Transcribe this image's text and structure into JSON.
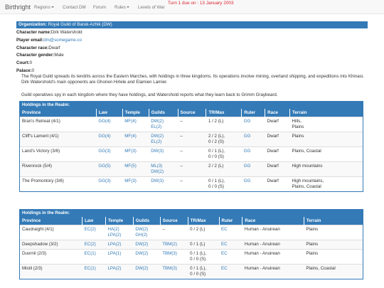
{
  "nav": {
    "brand": "Birthright",
    "items": [
      {
        "label": "Regions",
        "dropdown": true
      },
      {
        "label": "Contact DM",
        "dropdown": false
      },
      {
        "label": "Forum",
        "dropdown": false
      },
      {
        "label": "Rules",
        "dropdown": true
      },
      {
        "label": "Levels of War",
        "dropdown": false
      }
    ],
    "turn_notice": "Turn 1 due on : 13 January 2003"
  },
  "org": {
    "header_label": "Organization:",
    "header_value": "Royal Guild of Baruk-Azhik (DW)",
    "fields": [
      {
        "label": "Character name:",
        "value": "Dirk Watershold",
        "link": false
      },
      {
        "label": "Player email:",
        "value": "dm@somegame.co",
        "link": true
      },
      {
        "label": "Character race:",
        "value": "Dwarf",
        "link": false
      },
      {
        "label": "Character gender:",
        "value": "Male",
        "link": false
      },
      {
        "label": "Court:",
        "value": "0",
        "link": false
      },
      {
        "label": "Palace:",
        "value": "0",
        "link": false
      }
    ],
    "description_1": "The Royal Guild spreads its tendrils across the Eastern Marches, with holdings in three kingdoms. Its operations involve mining, overland shipping, and expeditions into Khinasi. Dirk Watershold's main opponents are Ghorien Hirlele and Elamien Lamier.",
    "description_2": "Guild operatives spy in each kingdom where they have holdings, and Watershold reports what they learn back to Grimm Graybeard."
  },
  "realms": [
    {
      "title": "Holdings in the Realm:",
      "columns": [
        "Province",
        "Law",
        "Temple",
        "Guilds",
        "Source",
        "TR/Max",
        "Ruler",
        "Race",
        "Terrain"
      ],
      "rows": [
        {
          "province": "Bran's Retreat (4/1)",
          "law": "GG(4)",
          "temple": "MF(4)",
          "guilds": [
            "DW(2)",
            "EL(2)"
          ],
          "source": "--",
          "trmax": [
            "1 / 2 (L)"
          ],
          "ruler": "GG",
          "race": "Dwarf",
          "terrain": [
            "Hills,",
            "Plains"
          ]
        },
        {
          "province": "Cliff's Lament (4/1)",
          "law": "GG(4)",
          "temple": "MF(4)",
          "guilds": [
            "DW(2)",
            "EL(2)"
          ],
          "source": "--",
          "trmax": [
            "2 / 2 (L),",
            "0 / 2 (S)"
          ],
          "ruler": "GG",
          "race": "Dwarf",
          "terrain": [
            "Plains"
          ]
        },
        {
          "province": "Land's Victory (3/6)",
          "law": "GG(3)",
          "temple": "MF(3)",
          "guilds": [
            "DW(3)"
          ],
          "source": "--",
          "trmax": [
            "0 / 1 (L),",
            "0 / 0 (S)"
          ],
          "ruler": "GG",
          "race": "Dwarf",
          "terrain": [
            "Plains, Coastal"
          ]
        },
        {
          "province": "Rivenrock (5/4)",
          "law": "GG(5)",
          "temple": "MF(5)",
          "guilds": [
            "ML(3)",
            "DW(2)"
          ],
          "source": "--",
          "trmax": [
            "2 / 2 (L)"
          ],
          "ruler": "GG",
          "race": "Dwarf",
          "terrain": [
            "High mountains"
          ]
        },
        {
          "province": "The Promontory (3/6)",
          "law": "GG(3)",
          "temple": "MF(3)",
          "guilds": [
            "DW(3)"
          ],
          "source": "--",
          "trmax": [
            "0 / 1 (L),",
            "0 / 0 (S)"
          ],
          "ruler": "GG",
          "race": "Dwarf",
          "terrain": [
            "High mountains,",
            "Plains, Coastal"
          ]
        }
      ]
    },
    {
      "title": "Holdings in the Realm:",
      "columns": [
        "Province",
        "Law",
        "Temple",
        "Guilds",
        "Source",
        "TR/Max",
        "Ruler",
        "Race",
        "Terrain"
      ],
      "rows": [
        {
          "province": "Caudraight (4/1)",
          "law": "EC(2)",
          "temple": [
            "HA(2)",
            "LPA(2)"
          ],
          "guilds": [
            "DW(2)",
            "GH(2)"
          ],
          "source": "--",
          "trmax": [
            "0 / 2 (L)"
          ],
          "ruler": "EC",
          "race": "Human - Anuirean",
          "terrain": [
            "Plains"
          ]
        },
        {
          "province": "Deepshadow (3/2)",
          "law": "EC(2)",
          "temple": [
            "LPA(2)"
          ],
          "guilds": [
            "DW(2)"
          ],
          "source": "TBM(2)",
          "trmax": [
            "0 / 1 (L)"
          ],
          "ruler": "EC",
          "race": "Human - Anuirean",
          "terrain": [
            "Plains"
          ]
        },
        {
          "province": "Duornil (2/3)",
          "law": "EC(1)",
          "temple": [
            "LPA(1)"
          ],
          "guilds": [
            "DW(2)"
          ],
          "source": "TBM(3)",
          "trmax": [
            "0 / 1 (L),",
            "0 / 0 (S)"
          ],
          "ruler": "EC",
          "race": "Human - Anuirean",
          "terrain": [
            "Plains"
          ]
        },
        {
          "province": "Mistil (2/3)",
          "law": "EC(1)",
          "temple": [
            "LPA(2)"
          ],
          "guilds": [
            "DW(2)"
          ],
          "source": "TBM(3)",
          "trmax": [
            "0 / 1 (L),",
            "0 / 0 (S)"
          ],
          "ruler": "EC",
          "race": "Human - Anuirean",
          "terrain": [
            "Plains, Coastal"
          ]
        }
      ]
    }
  ]
}
